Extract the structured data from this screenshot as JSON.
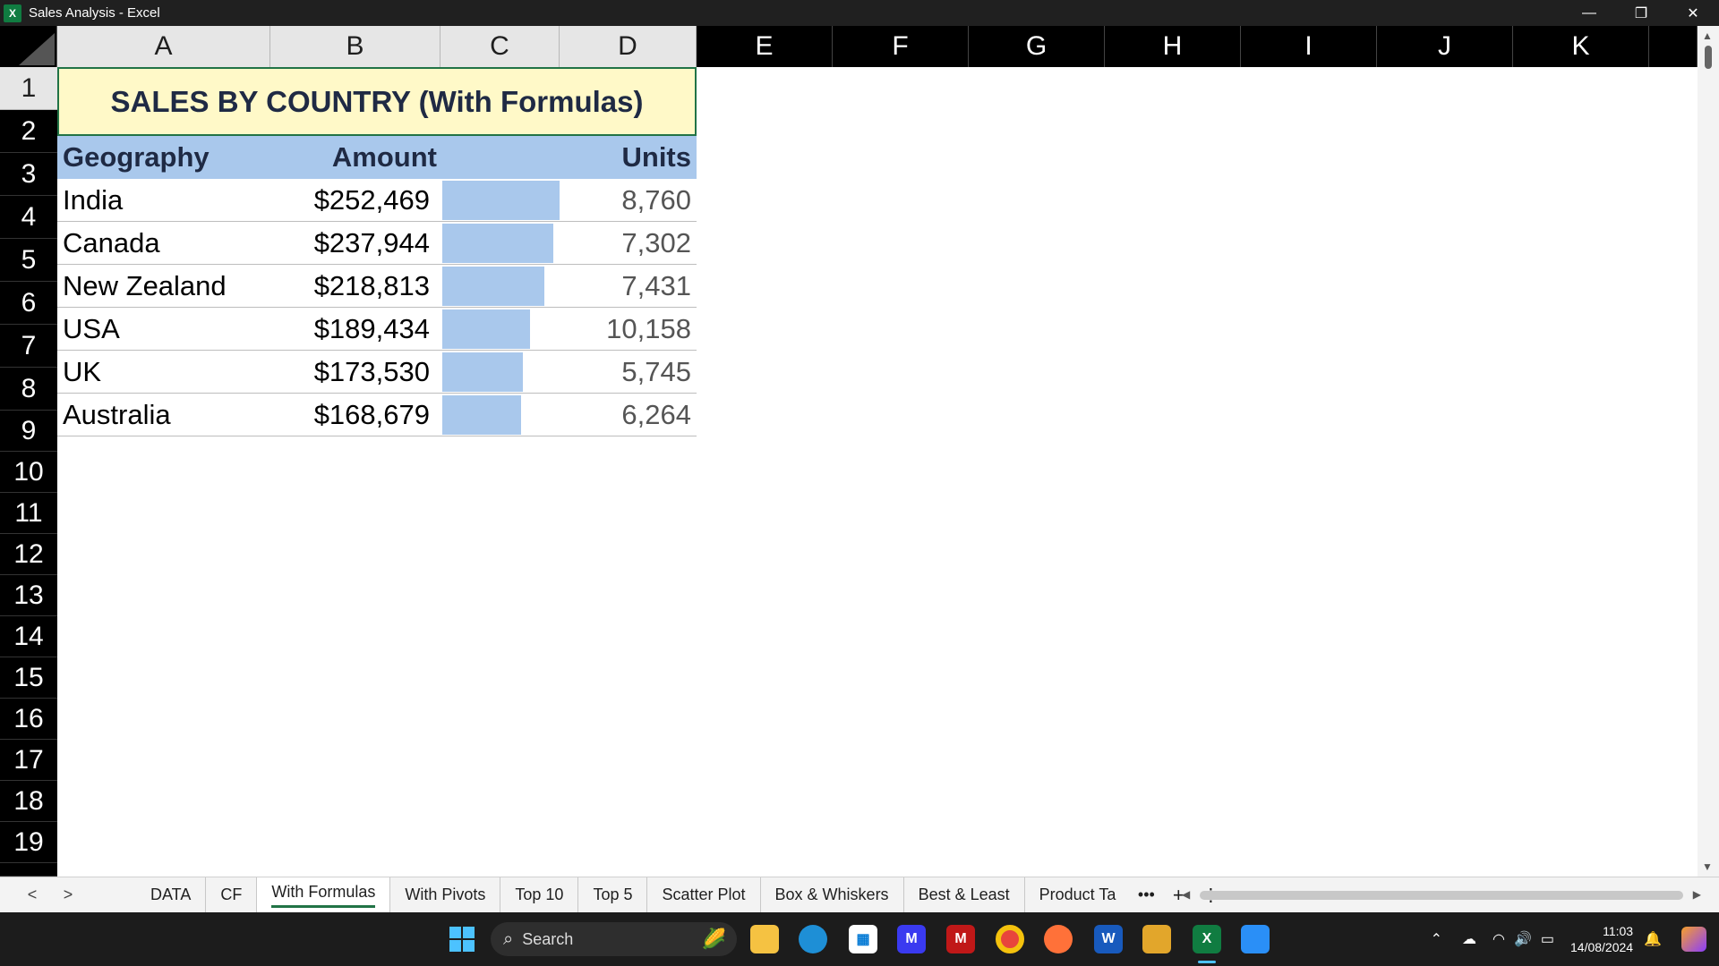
{
  "window": {
    "title": "Sales Analysis - Excel",
    "app_icon": "X",
    "controls": [
      "—",
      "❐",
      "✕"
    ]
  },
  "columns": [
    "A",
    "B",
    "C",
    "D",
    "E",
    "F",
    "G",
    "H",
    "I",
    "J",
    "K"
  ],
  "rows": [
    "1",
    "2",
    "3",
    "4",
    "5",
    "6",
    "7",
    "8",
    "9",
    "10",
    "11",
    "12",
    "13",
    "14",
    "15",
    "16",
    "17",
    "18",
    "19"
  ],
  "sheet": {
    "title": "SALES BY COUNTRY (With Formulas)",
    "headers": {
      "geography": "Geography",
      "amount": "Amount",
      "units": "Units"
    },
    "data": [
      {
        "geography": "India",
        "amount": "$252,469",
        "units": "8,760",
        "bar_fraction": 1.0
      },
      {
        "geography": "Canada",
        "amount": "$237,944",
        "units": "7,302",
        "bar_fraction": 0.943
      },
      {
        "geography": "New Zealand",
        "amount": "$218,813",
        "units": "7,431",
        "bar_fraction": 0.867
      },
      {
        "geography": "USA",
        "amount": "$189,434",
        "units": "10,158",
        "bar_fraction": 0.75
      },
      {
        "geography": "UK",
        "amount": "$173,530",
        "units": "5,745",
        "bar_fraction": 0.687
      },
      {
        "geography": "Australia",
        "amount": "$168,679",
        "units": "6,264",
        "bar_fraction": 0.668
      }
    ],
    "bar_color": "#a9c8ec",
    "header_color": "#a9c8ec",
    "title_bg": "#fff9c8"
  },
  "tabs": {
    "nav_prev": "<",
    "nav_next": ">",
    "items": [
      "DATA",
      "CF",
      "With Formulas",
      "With Pivots",
      "Top 10",
      "Top 5",
      "Scatter Plot",
      "Box & Whiskers",
      "Best & Least",
      "Product Ta"
    ],
    "active": "With Formulas",
    "more": "•••",
    "add": "+",
    "options": "⋮"
  },
  "taskbar": {
    "search_label": "Search",
    "time": "11:03",
    "date": "14/08/2024",
    "icons": [
      "windows-start-icon",
      "file-explorer-icon",
      "edge-icon",
      "store-icon",
      "mcafee-icon",
      "chrome-icon",
      "firefox-icon",
      "word-icon",
      "snip-icon",
      "excel-icon",
      "photos-icon"
    ]
  }
}
